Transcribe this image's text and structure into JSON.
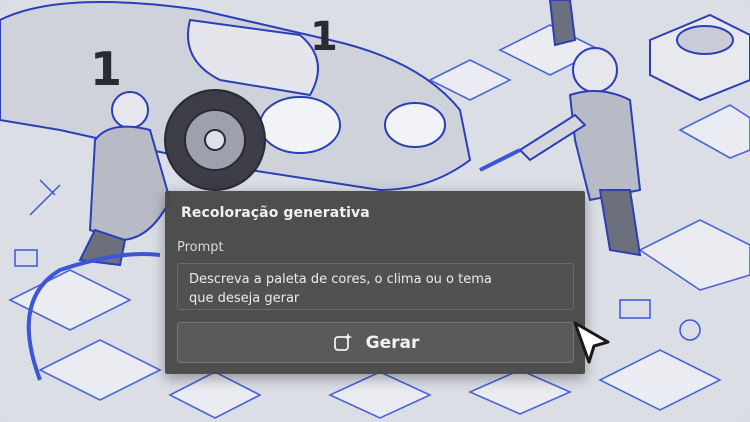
{
  "panel": {
    "title": "Recoloração generativa",
    "prompt_label": "Prompt",
    "prompt_lines": [
      "Descreva a paleta de cores, o clima ou o tema",
      "que deseja gerar"
    ],
    "generate_label": "Gerar",
    "generate_icon": "sparkle-square-icon"
  },
  "background": {
    "description_icon": "illustration",
    "colors": {
      "line": "#3b57d8",
      "fill": "#d4d6dc",
      "ink": "#2a2a33"
    }
  },
  "cursor": {
    "icon": "arrow-cursor-icon"
  }
}
